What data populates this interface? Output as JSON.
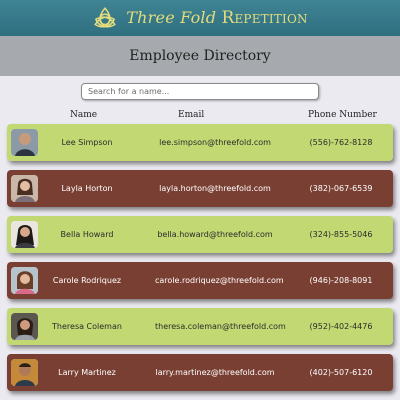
{
  "header": {
    "brand_script": "Three Fold",
    "brand_caps": "Repetition"
  },
  "page": {
    "title": "Employee Directory"
  },
  "search": {
    "placeholder": "Search for a name..."
  },
  "columns": {
    "name": "Name",
    "email": "Email",
    "phone": "Phone Number"
  },
  "colors": {
    "light_row": "#c2d872",
    "dark_row": "#7a3f33",
    "header": "#3f8494",
    "brand": "#e2dc7c"
  },
  "employees": [
    {
      "name": "Lee Simpson",
      "email": "lee.simpson@threefold.com",
      "phone": "(556)-762-8128"
    },
    {
      "name": "Layla Horton",
      "email": "layla.horton@threefold.com",
      "phone": "(382)-067-6539"
    },
    {
      "name": "Bella Howard",
      "email": "bella.howard@threefold.com",
      "phone": "(324)-855-5046"
    },
    {
      "name": "Carole Rodriquez",
      "email": "carole.rodriquez@threefold.com",
      "phone": "(946)-208-8091"
    },
    {
      "name": "Theresa Coleman",
      "email": "theresa.coleman@threefold.com",
      "phone": "(952)-402-4476"
    },
    {
      "name": "Larry Martinez",
      "email": "larry.martinez@threefold.com",
      "phone": "(402)-507-6120"
    }
  ]
}
